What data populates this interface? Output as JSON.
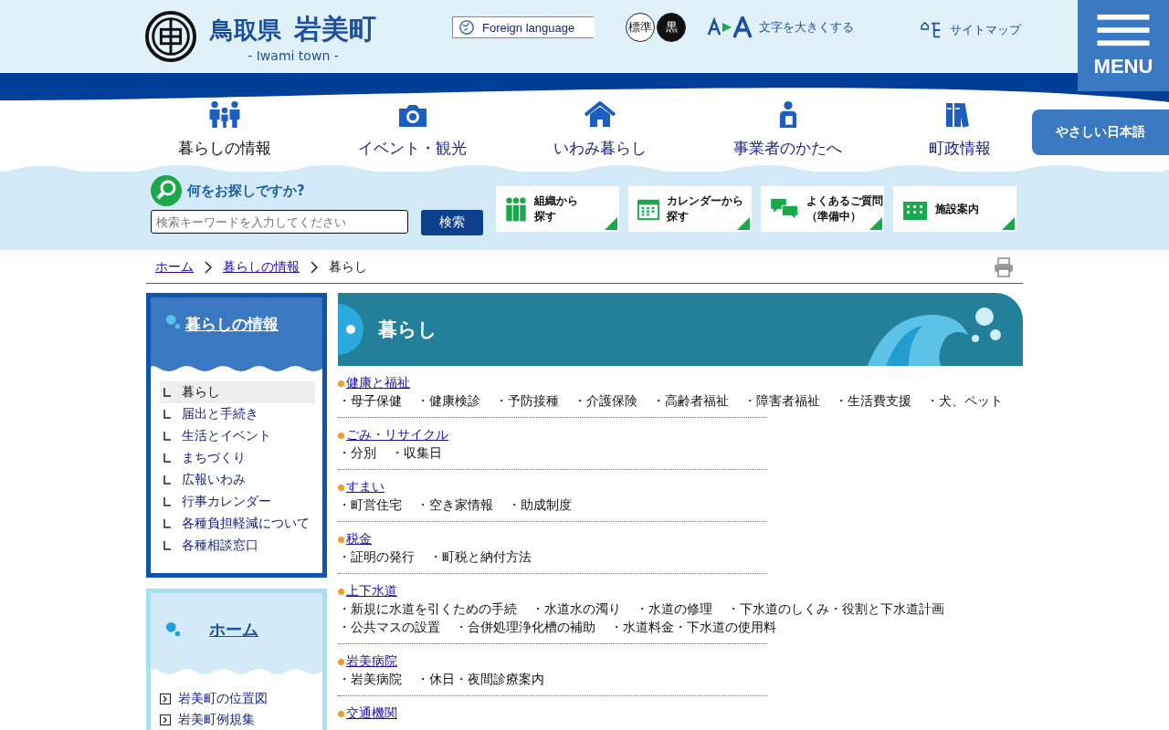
{
  "header": {
    "prefecture": "鳥取県",
    "town": "岩美町",
    "town_en": "- Iwami town -",
    "language_button": "Foreign language",
    "contrast_options": [
      {
        "label": "標準",
        "kind": "standard"
      },
      {
        "label": "黒",
        "kind": "black"
      }
    ],
    "font_size_link": "文字を大きくする",
    "sitemap_link": "サイトマップ",
    "menu_button": "MENU"
  },
  "easy_japanese_button": "やさしい日本語",
  "main_nav": [
    {
      "label": "暮らしの情報"
    },
    {
      "label": "イベント・観光"
    },
    {
      "label": "いわみ暮らし"
    },
    {
      "label": "事業者のかたへ"
    },
    {
      "label": "町政情報"
    }
  ],
  "search": {
    "heading": "何をお探しですか?",
    "placeholder": "検索キーワードを入力してください",
    "button": "検索"
  },
  "quick_links": [
    {
      "lines": [
        "組織から",
        "探す"
      ]
    },
    {
      "lines": [
        "カレンダーから",
        "探す"
      ]
    },
    {
      "lines": [
        "よくあるご質問",
        "（準備中）"
      ]
    },
    {
      "lines": [
        "施設案内"
      ]
    }
  ],
  "breadcrumb": [
    "ホーム",
    "暮らしの情報",
    "暮らし"
  ],
  "sidebar": {
    "section_title": "暮らしの情報",
    "items": [
      {
        "label": "暮らし",
        "selected": true
      },
      {
        "label": "届出と手続き",
        "selected": false
      },
      {
        "label": "生活とイベント",
        "selected": false
      },
      {
        "label": "まちづくり",
        "selected": false
      },
      {
        "label": "広報いわみ",
        "selected": false
      },
      {
        "label": "行事カレンダー",
        "selected": false
      },
      {
        "label": "各種負担軽減について",
        "selected": false
      },
      {
        "label": "各種相談窓口",
        "selected": false
      }
    ],
    "home_title": "ホーム",
    "home_links": [
      "岩美町の位置図",
      "岩美町例規集"
    ]
  },
  "page_title": "暮らし",
  "categories": [
    {
      "title": "健康と福祉",
      "items": [
        "・母子保健",
        "・健康検診",
        "・予防接種",
        "・介護保険",
        "・高齢者福祉",
        "・障害者福祉",
        "・生活費支援",
        "・犬、ペット"
      ]
    },
    {
      "title": "ごみ・リサイクル",
      "items": [
        "・分別",
        "・収集日"
      ]
    },
    {
      "title": "すまい",
      "items": [
        "・町営住宅",
        "・空き家情報",
        "・助成制度"
      ]
    },
    {
      "title": "税金",
      "items": [
        "・証明の発行",
        "・町税と納付方法"
      ]
    },
    {
      "title": "上下水道",
      "items": [
        "・新規に水道を引くための手続",
        "・水道水の濁り",
        "・水道の修理",
        "・下水道のしくみ・役割と下水道計画",
        "・公共マスの設置",
        "・合併処理浄化槽の補助",
        "・水道料金・下水道の使用料"
      ]
    },
    {
      "title": "岩美病院",
      "items": [
        "・岩美病院",
        "・休日・夜間診療案内"
      ]
    },
    {
      "title": "交通機関"
    }
  ]
}
